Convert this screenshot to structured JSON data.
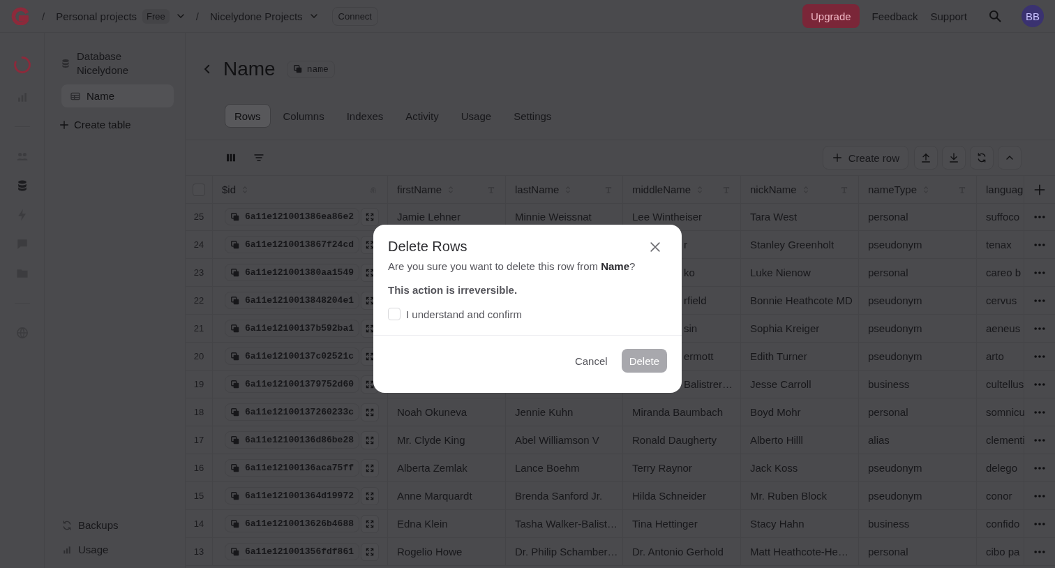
{
  "topbar": {
    "separator": "/",
    "breadcrumbs": [
      {
        "label": "Personal projects",
        "badge": "Free",
        "dropdown": true
      },
      {
        "label": "Nicelydone Projects",
        "dropdown": true
      }
    ],
    "connect": "Connect",
    "upgrade": "Upgrade",
    "links": [
      "Feedback",
      "Support"
    ],
    "avatar": "BB"
  },
  "sidebar": {
    "database": "Database Nicelydone",
    "tables": [
      {
        "label": "Name",
        "selected": true
      }
    ],
    "create_table": "Create table",
    "footer_items": [
      "Backups",
      "Usage"
    ]
  },
  "page": {
    "title": "Name",
    "id_badge": "name",
    "tabs": [
      {
        "label": "Rows",
        "selected": true
      },
      {
        "label": "Columns",
        "selected": false
      },
      {
        "label": "Indexes",
        "selected": false
      },
      {
        "label": "Activity",
        "selected": false
      },
      {
        "label": "Usage",
        "selected": false
      },
      {
        "label": "Settings",
        "selected": false
      }
    ]
  },
  "toolbar": {
    "create_row": "Create row"
  },
  "table": {
    "columns": [
      {
        "label": "$id",
        "kind": "id"
      },
      {
        "label": "firstName",
        "kind": "text"
      },
      {
        "label": "lastName",
        "kind": "text"
      },
      {
        "label": "middleName",
        "kind": "text"
      },
      {
        "label": "nickName",
        "kind": "text"
      },
      {
        "label": "nameType",
        "kind": "text"
      },
      {
        "label": "languag",
        "kind": "text"
      }
    ],
    "all_selected": false,
    "rows": [
      {
        "number": "25",
        "cells": [
          "6a11e121001386ea86e2",
          "Jamie Lehner",
          "Minnie Weissnat",
          "Lee Wintheiser",
          "Tara West",
          "personal",
          "suffoco"
        ]
      },
      {
        "number": "24",
        "cells": [
          "6a11e1210013867f24cd",
          null,
          null,
          {
            "text": "r",
            "covered": true
          },
          "Stanley Greenholt",
          "pseudonym",
          "tenax"
        ]
      },
      {
        "number": "23",
        "cells": [
          "6a11e121001380aa1549",
          null,
          null,
          {
            "text": "ko",
            "covered": true
          },
          "Luke Nienow",
          "personal",
          "careo b"
        ]
      },
      {
        "number": "22",
        "cells": [
          "6a11e1210013848204e1",
          null,
          null,
          {
            "text": "rfield",
            "covered": true
          },
          "Bonnie Heathcote MD",
          "pseudonym",
          "cervus"
        ]
      },
      {
        "number": "21",
        "cells": [
          "6a11e12100137b592ba1",
          null,
          null,
          {
            "text": "sin",
            "covered": true
          },
          "Sophia Kreiger",
          "pseudonym",
          "aeneus"
        ]
      },
      {
        "number": "20",
        "cells": [
          "6a11e12100137c02521c",
          null,
          null,
          {
            "text": "ermott",
            "covered": true
          },
          "Edith Turner",
          "pseudonym",
          "arto"
        ]
      },
      {
        "number": "19",
        "cells": [
          "6a11e121001379752d60",
          null,
          null,
          {
            "text": "Balistrer…",
            "covered": true
          },
          "Jesse Carroll",
          "business",
          "cultellus"
        ]
      },
      {
        "number": "18",
        "cells": [
          "6a11e12100137260233c",
          "Noah Okuneva",
          "Jennie Kuhn",
          "Miranda Baumbach",
          "Boyd Mohr",
          "personal",
          "somnicu"
        ]
      },
      {
        "number": "17",
        "cells": [
          "6a11e12100136d86be28",
          "Mr. Clyde King",
          "Abel Williamson V",
          "Ronald Daugherty",
          "Alberto Hilll",
          "alias",
          "clementi"
        ]
      },
      {
        "number": "16",
        "cells": [
          "6a11e12100136aca75ff",
          "Alberta Zemlak",
          "Lance Boehm",
          "Terry Raynor",
          "Jack Koss",
          "pseudonym",
          "delego"
        ]
      },
      {
        "number": "15",
        "cells": [
          "6a11e121001364d19972",
          "Anne Marquardt",
          "Brenda Sanford Jr.",
          "Hilda Schneider",
          "Mr. Ruben Block",
          "pseudonym",
          "conor"
        ]
      },
      {
        "number": "14",
        "cells": [
          "6a11e1210013626b4688",
          "Edna Klein",
          "Tasha Walker-Balist…",
          "Tina Hettinger",
          "Stacy Hahn",
          "business",
          "confido"
        ]
      },
      {
        "number": "13",
        "cells": [
          "6a11e121001356fdf861",
          "Rogelio Howe",
          "Dr. Philip Schamber…",
          "Dr. Antonio Gerhold",
          "Matt Heathcote-He…",
          "personal",
          "cibo pa"
        ]
      }
    ]
  },
  "modal": {
    "title": "Delete Rows",
    "message": "Are you sure you want to delete this row from **Name**?",
    "warning": "This action is irreversible.",
    "confirm_label": "I understand and confirm",
    "confirm_checked": false,
    "cancel": "Cancel",
    "delete": "Delete",
    "delete_disabled": true
  }
}
